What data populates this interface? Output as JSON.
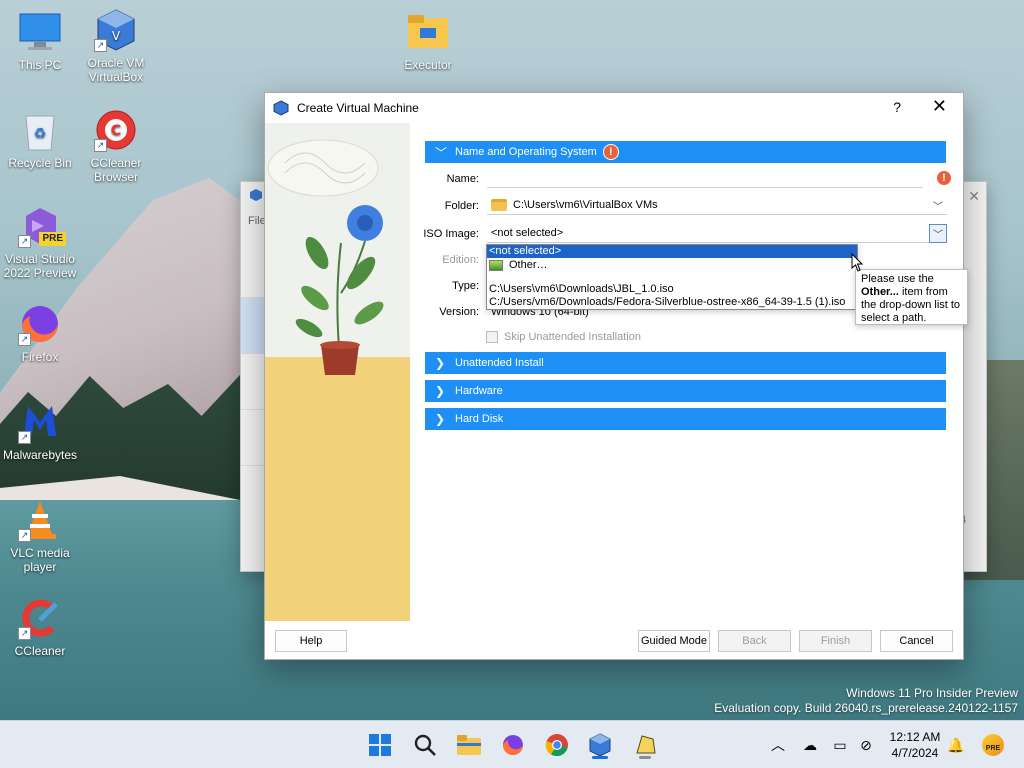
{
  "desktop": {
    "icons": [
      {
        "label": "This PC"
      },
      {
        "label": "Oracle VM VirtualBox"
      },
      {
        "label": "Executor"
      },
      {
        "label": "Recycle Bin"
      },
      {
        "label": "CCleaner Browser"
      },
      {
        "label": "Visual Studio 2022 Preview"
      },
      {
        "label": "Firefox"
      },
      {
        "label": "Malwarebytes"
      },
      {
        "label": "VLC media player"
      },
      {
        "label": "CCleaner"
      }
    ],
    "vs_badge": "PRE",
    "watermark_line1": "Windows 11 Pro Insider Preview",
    "watermark_line2": "Evaluation copy. Build 26040.rs_prerelease.240122-1157"
  },
  "bg_window": {
    "menu_fragment": "File",
    "right_fragment": "4"
  },
  "dialog": {
    "title": "Create Virtual Machine",
    "help_glyph": "?",
    "close_glyph": "✕",
    "sections": [
      {
        "label": "Name and Operating System",
        "expanded": true,
        "warning": true
      },
      {
        "label": "Unattended Install",
        "expanded": false
      },
      {
        "label": "Hardware",
        "expanded": false
      },
      {
        "label": "Hard Disk",
        "expanded": false
      }
    ],
    "form": {
      "name_label": "Name:",
      "name_value": "",
      "folder_label": "Folder:",
      "folder_value": "C:\\Users\\vm6\\VirtualBox VMs",
      "iso_label": "ISO Image:",
      "iso_value": "<not selected>",
      "edition_label": "Edition:",
      "type_label": "Type:",
      "version_label": "Version:",
      "version_value": "Windows 10 (64-bit)",
      "skip_label": "Skip Unattended Installation"
    },
    "iso_dropdown": {
      "items": [
        "<not selected>",
        "Other…",
        "C:\\Users\\vm6\\Downloads\\JBL_1.0.iso",
        "C:/Users/vm6/Downloads/Fedora-Silverblue-ostree-x86_64-39-1.5 (1).iso"
      ],
      "selected_index": 0
    },
    "tooltip": {
      "line1": "Please use the",
      "bold": "Other...",
      "line2_rest": " item from",
      "line3": "the drop-down list to",
      "line4": "select a path."
    },
    "buttons": {
      "help": "Help",
      "guided": "Guided Mode",
      "back": "Back",
      "finish": "Finish",
      "cancel": "Cancel"
    }
  },
  "taskbar": {
    "time": "12:12 AM",
    "date": "4/7/2024",
    "apps": [
      "start-icon",
      "search-icon",
      "file-explorer-icon",
      "firefox-icon",
      "chrome-icon",
      "virtualbox-icon",
      "executor-icon"
    ],
    "tray_badge": "PRE"
  },
  "colors": {
    "accent": "#1e90f5",
    "selection": "#1e63c8",
    "warning": "#e8613a"
  }
}
